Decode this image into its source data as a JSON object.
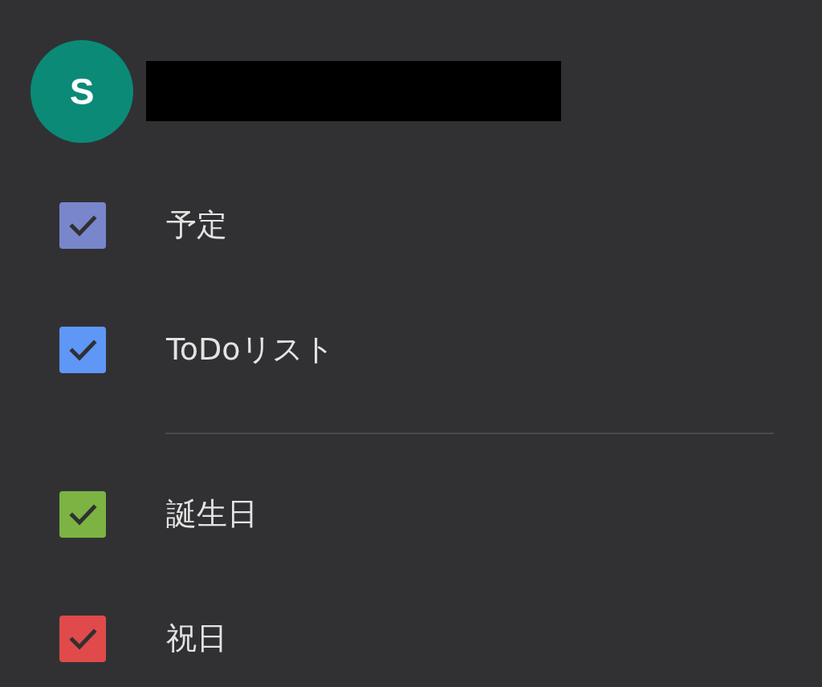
{
  "account": {
    "avatar_letter": "S",
    "name_redacted": true
  },
  "calendar_groups": [
    {
      "items": [
        {
          "label": "予定",
          "checked": true,
          "color": "#7986cb"
        },
        {
          "label": "ToDoリスト",
          "checked": true,
          "color": "#5e97f6"
        }
      ]
    },
    {
      "items": [
        {
          "label": "誕生日",
          "checked": true,
          "color": "#7cb342"
        },
        {
          "label": "祝日",
          "checked": true,
          "color": "#e04a4a"
        }
      ]
    }
  ]
}
